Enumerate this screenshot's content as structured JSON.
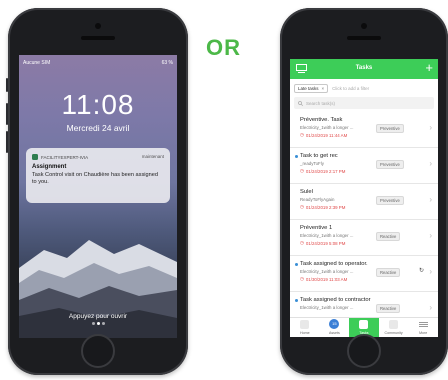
{
  "or_text": "OR",
  "lockscreen": {
    "carrier": "Aucune SIM",
    "battery": "63 %",
    "time": "11:08",
    "date": "Mercredi 24 avril",
    "notification": {
      "app": "FACILITYEXPERT-IVIA",
      "when": "maintenant",
      "title": "Assignment",
      "message": "Task Control visit on Chaudière has been assigned to you."
    },
    "unlock_hint": "Appuyez pour ouvrir"
  },
  "app": {
    "header_title": "Tasks",
    "filter_chip": "Late tasks",
    "add_filter": "Click to add a filter",
    "search_placeholder": "Search task(s)",
    "tasks": [
      {
        "name": "Préventive. Task",
        "sub": "Electricity_1with a longer ...",
        "date": "01/24/2019 11:44 AM",
        "type": "Preventive"
      },
      {
        "name": "Task to get rec",
        "sub": "_readyToFly",
        "date": "01/24/2019 2:17 PM",
        "type": "Preventive"
      },
      {
        "name": "Sulel",
        "sub": "ReadyToFlyAgain",
        "date": "01/24/2019 2:39 PM",
        "type": "Preventive"
      },
      {
        "name": "Préventive 1",
        "sub": "Electricity_1with a longer ...",
        "date": "01/24/2019 5:08 PM",
        "type": "Reactive"
      },
      {
        "name": "Task assigned to operator.",
        "sub": "Electricity_1with a longer ...",
        "date": "01/30/2019 11:03 AM",
        "type": "Reactive"
      },
      {
        "name": "Task assigned to contractor",
        "sub": "Electricity_1with a longer ...",
        "date": "",
        "type": "Reactive"
      }
    ],
    "tabs": [
      {
        "label": "Home"
      },
      {
        "label": "Assets",
        "count": "15"
      },
      {
        "label": "Tasks"
      },
      {
        "label": "Community"
      },
      {
        "label": "More"
      }
    ]
  },
  "colors": {
    "brand_green": "#3dcd58",
    "or_green": "#4cb848",
    "date_red": "#e04848"
  }
}
